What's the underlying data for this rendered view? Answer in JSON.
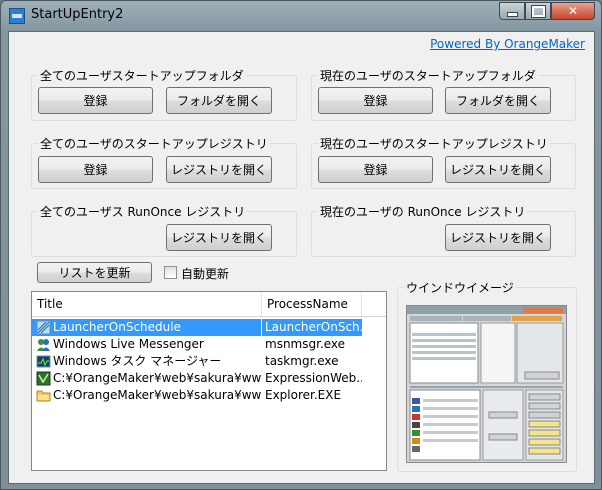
{
  "window": {
    "title": "StartUpEntry2"
  },
  "powered_by": "Powered By OrangeMaker",
  "groups": {
    "all_startup_folder": {
      "label": "全てのユーザスタートアップフォルダ",
      "register": "登録",
      "open": "フォルダを開く"
    },
    "cur_startup_folder": {
      "label": "現在のユーザのスタートアップフォルダ",
      "register": "登録",
      "open": "フォルダを開く"
    },
    "all_startup_registry": {
      "label": "全てのユーザのスタートアップレジストリ",
      "register": "登録",
      "open": "レジストリを開く"
    },
    "cur_startup_registry": {
      "label": "現在のユーザのスタートアップレジストリ",
      "register": "登録",
      "open": "レジストリを開く"
    },
    "all_runonce": {
      "label": "全てのユーザス RunOnce レジストリ",
      "open": "レジストリを開く"
    },
    "cur_runonce": {
      "label": "現在のユーザの RunOnce レジストリ",
      "open": "レジストリを開く"
    }
  },
  "controls": {
    "refresh": "リストを更新",
    "auto_refresh": "自動更新",
    "auto_refresh_checked": false
  },
  "list": {
    "columns": [
      "Title",
      "ProcessName"
    ],
    "rows": [
      {
        "title": "LauncherOnSchedule",
        "process": "LauncherOnSch...",
        "icon": "schedule-icon",
        "selected": true
      },
      {
        "title": "Windows Live Messenger",
        "process": "msnmsgr.exe",
        "icon": "messenger-icon",
        "selected": false
      },
      {
        "title": "Windows タスク マネージャー",
        "process": "taskmgr.exe",
        "icon": "task-manager-icon",
        "selected": false
      },
      {
        "title": "C:¥OrangeMaker¥web¥sakura¥www - M...",
        "process": "ExpressionWeb...",
        "icon": "expression-web-icon",
        "selected": false
      },
      {
        "title": "C:¥OrangeMaker¥web¥sakura¥www¥do...",
        "process": "Explorer.EXE",
        "icon": "folder-icon",
        "selected": false
      }
    ]
  },
  "preview": {
    "label": "ウインドウイメージ"
  },
  "colors": {
    "selection": "#3399ff",
    "link": "#0066cc",
    "close": "#c7442a"
  }
}
